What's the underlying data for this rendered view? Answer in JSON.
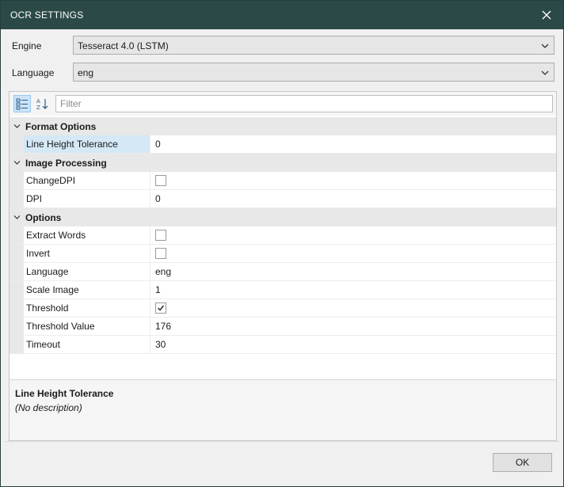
{
  "window": {
    "title": "OCR SETTINGS",
    "close_icon": "close-icon"
  },
  "engine": {
    "label": "Engine",
    "value": "Tesseract 4.0 (LSTM)"
  },
  "language": {
    "label": "Language",
    "value": "eng"
  },
  "toolbar": {
    "categorized_icon": "categorized-icon",
    "alphabetical_icon": "sort-alphabetical-icon",
    "filter_placeholder": "Filter"
  },
  "categories": [
    {
      "label": "Format Options",
      "properties": [
        {
          "name": "Line Height Tolerance",
          "type": "text",
          "value": "0",
          "selected": true
        }
      ]
    },
    {
      "label": "Image Processing",
      "properties": [
        {
          "name": "ChangeDPI",
          "type": "checkbox",
          "checked": false
        },
        {
          "name": "DPI",
          "type": "text",
          "value": "0"
        }
      ]
    },
    {
      "label": "Options",
      "properties": [
        {
          "name": "Extract Words",
          "type": "checkbox",
          "checked": false
        },
        {
          "name": "Invert",
          "type": "checkbox",
          "checked": false
        },
        {
          "name": "Language",
          "type": "text",
          "value": "eng"
        },
        {
          "name": "Scale Image",
          "type": "text",
          "value": "1"
        },
        {
          "name": "Threshold",
          "type": "checkbox",
          "checked": true
        },
        {
          "name": "Threshold Value",
          "type": "text",
          "value": "176"
        },
        {
          "name": "Timeout",
          "type": "text",
          "value": "30"
        }
      ]
    }
  ],
  "description": {
    "title": "Line Height Tolerance",
    "text": "(No description)"
  },
  "footer": {
    "ok_label": "OK"
  },
  "colors": {
    "titlebar": "#2b4a47",
    "selected_row": "#d4e8f5",
    "category_bg": "#e8e8e8"
  }
}
